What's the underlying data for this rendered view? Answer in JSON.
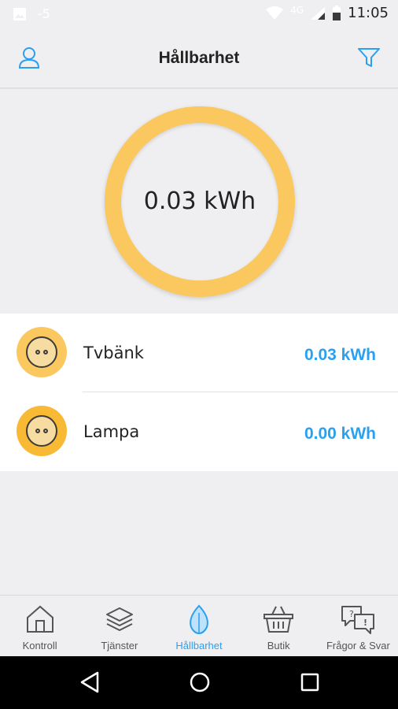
{
  "status_bar": {
    "time": "11:05",
    "notification_count": "-5",
    "network": "4G"
  },
  "header": {
    "title": "Hållbarhet",
    "profile_icon": "user-icon",
    "filter_icon": "filter-icon"
  },
  "gauge": {
    "value_label": "0.03 kWh",
    "accent_color": "#fbc860"
  },
  "devices": [
    {
      "name": "Tvbänk",
      "value": "0.03 kWh",
      "icon": "plug-icon"
    },
    {
      "name": "Lampa",
      "value": "0.00 kWh",
      "icon": "plug-icon"
    }
  ],
  "bottom_nav": [
    {
      "label": "Kontroll",
      "icon": "house-icon",
      "active": false
    },
    {
      "label": "Tjänster",
      "icon": "layers-icon",
      "active": false
    },
    {
      "label": "Hållbarhet",
      "icon": "leaf-icon",
      "active": true
    },
    {
      "label": "Butik",
      "icon": "basket-icon",
      "active": false
    },
    {
      "label": "Frågor & Svar",
      "icon": "chat-question-icon",
      "active": false
    }
  ],
  "colors": {
    "accent_blue": "#2aa0f0",
    "accent_yellow": "#fbc860",
    "background": "#efeff1"
  }
}
